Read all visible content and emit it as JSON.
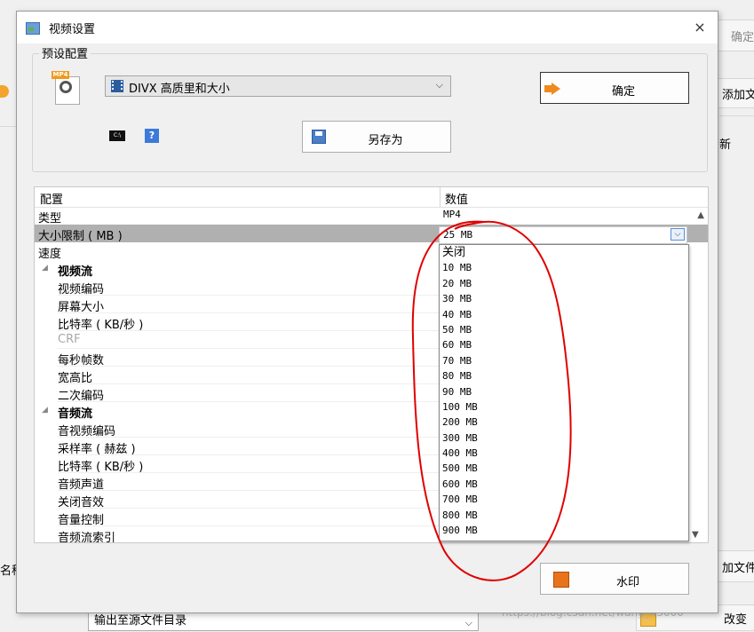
{
  "background": {
    "top_right_button": "确定",
    "add_file_button": "添加文",
    "new_label": "新",
    "name_label": "名称",
    "add_file_button2": "加文件",
    "output_select": "输出至源文件目录",
    "change_button": "改变",
    "watermark_text": "https://blog.csdn.net/wang_43000"
  },
  "dialog": {
    "title": "视频设置",
    "close": "×",
    "group_label": "预设配置",
    "preset_select": "DIVX 高质里和大小",
    "ok_button": "确定",
    "saveas_button": "另存为",
    "cmd_icon_text": "C:\\",
    "help_icon_text": "?",
    "watermark_button": "水印"
  },
  "grid": {
    "header_col1": "配置",
    "header_col2": "数值",
    "rows": [
      {
        "label": "类型",
        "value": "MP4",
        "kind": "top"
      },
      {
        "label": "大小限制 ( MB )",
        "value": "25 MB",
        "kind": "top",
        "selected": true
      },
      {
        "label": "速度",
        "value": "",
        "kind": "top"
      },
      {
        "label": "视频流",
        "kind": "cat"
      },
      {
        "label": "视频编码",
        "kind": "item"
      },
      {
        "label": "屏幕大小",
        "kind": "item"
      },
      {
        "label": "比特率 ( KB/秒 )",
        "kind": "item"
      },
      {
        "label": "CRF",
        "kind": "item",
        "disabled": true
      },
      {
        "label": "每秒帧数",
        "kind": "item"
      },
      {
        "label": "宽高比",
        "kind": "item"
      },
      {
        "label": "二次编码",
        "kind": "item"
      },
      {
        "label": "音频流",
        "kind": "cat"
      },
      {
        "label": "音视频编码",
        "kind": "item"
      },
      {
        "label": "采样率 ( 赫兹 )",
        "kind": "item"
      },
      {
        "label": "比特率 ( KB/秒 )",
        "kind": "item"
      },
      {
        "label": "音频声道",
        "kind": "item"
      },
      {
        "label": "关闭音效",
        "kind": "item"
      },
      {
        "label": "音量控制",
        "kind": "item"
      },
      {
        "label": "音频流索引",
        "kind": "item"
      }
    ]
  },
  "size_combo": {
    "value": "25 MB",
    "options": [
      "关闭",
      "10 MB",
      "20 MB",
      "30 MB",
      "40 MB",
      "50 MB",
      "60 MB",
      "70 MB",
      "80 MB",
      "90 MB",
      "100 MB",
      "200 MB",
      "300 MB",
      "400 MB",
      "500 MB",
      "600 MB",
      "700 MB",
      "800 MB",
      "900 MB"
    ]
  },
  "icons": {
    "app": "video-settings-icon",
    "file": "mp4-file-icon",
    "preset": "film-icon",
    "ok": "arrow-right-icon",
    "save": "floppy-disk-icon",
    "cmd": "command-prompt-icon",
    "help": "help-icon",
    "watermark": "watermark-icon"
  },
  "colors": {
    "selected_row": "#b0b0b0",
    "annotation": "#e00000",
    "accent_orange": "#f08a1d"
  }
}
